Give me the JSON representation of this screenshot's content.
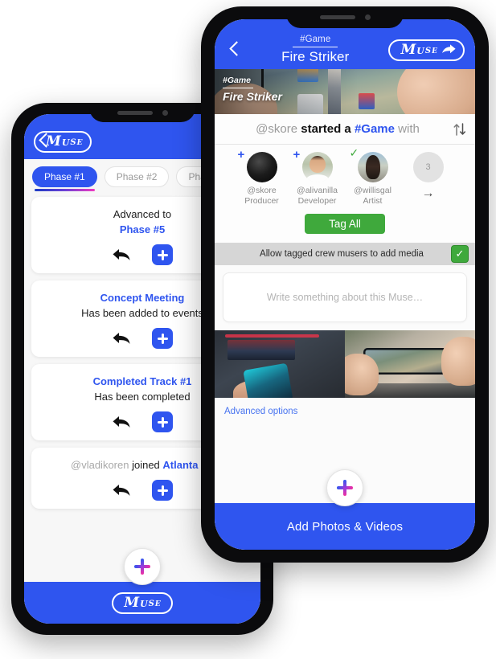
{
  "front_phone": {
    "header": {
      "back_icon": "chevron-left-icon",
      "hashtag": "#Game",
      "title": "Fire Striker",
      "logo_text": {
        "m": "M",
        "u": "U",
        "s": "S",
        "e": "E"
      },
      "share_icon": "share-arrow-icon"
    },
    "banner": {
      "hashtag": "#Game",
      "title": "Fire Striker"
    },
    "headline": {
      "user": "@skore",
      "verb": "started a",
      "tag": "#Game",
      "suffix": "with",
      "sort_icon": "sort-updown-icon"
    },
    "crew": [
      {
        "handle": "@skore",
        "role": "Producer",
        "badge": "+",
        "badge_type": "plus"
      },
      {
        "handle": "@alivanilla",
        "role": "Developer",
        "badge": "+",
        "badge_type": "plus"
      },
      {
        "handle": "@willisgal",
        "role": "Artist",
        "badge": "✓",
        "badge_type": "check"
      }
    ],
    "crew_more": {
      "count": "3",
      "arrow": "→"
    },
    "tag_all_label": "Tag All",
    "allow_row": {
      "label": "Allow tagged crew musers to add media",
      "checked": true,
      "check_glyph": "✓"
    },
    "composer_placeholder": "Write something about this Muse…",
    "advanced_options_label": "Advanced options",
    "fab_icon": "plus-icon",
    "bottom_label": "Add Photos & Videos"
  },
  "back_phone": {
    "header": {
      "back_icon": "chevron-left-icon",
      "logo_text": {
        "m": "M",
        "u": "U",
        "s": "S",
        "e": "E"
      }
    },
    "tabs": [
      {
        "label": "Phase #1",
        "active": true
      },
      {
        "label": "Phase #2",
        "active": false
      },
      {
        "label": "Phase #3",
        "active": false
      }
    ],
    "cards": [
      {
        "line1": "Advanced to",
        "line2_blue": "Phase #5",
        "line1_is_link": false
      },
      {
        "line1": "Concept Meeting",
        "line1_is_link": true,
        "line2": "Has been added to events"
      },
      {
        "line1": "Completed Track #1",
        "line1_is_link": true,
        "line2": "Has been completed"
      },
      {
        "line_muted": "@vladikoren",
        "line_plain": "joined",
        "line_blue": "Atlanta on"
      }
    ],
    "card_actions": {
      "reply_icon": "reply-arrow-icon",
      "add_icon": "plus-icon"
    },
    "fab_icon": "plus-icon"
  },
  "colors": {
    "brand_blue": "#2f55ef",
    "green": "#3fa93c",
    "gradient_start": "#2f55ef",
    "gradient_end": "#ef2fa0",
    "frame_black": "#0b0b0d"
  }
}
